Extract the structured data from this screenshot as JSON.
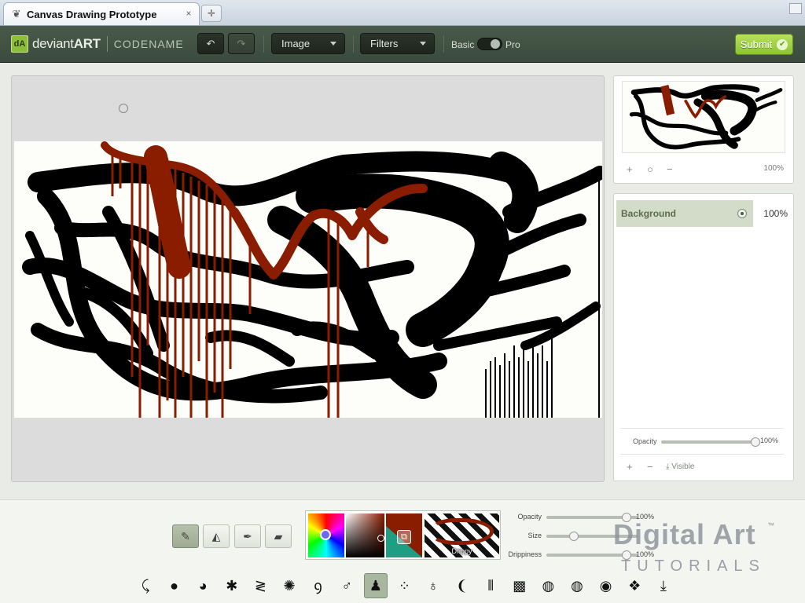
{
  "browser": {
    "tab_title": "Canvas Drawing Prototype",
    "tab_close": "×",
    "new_tab": "✛",
    "favicon": "fox-icon"
  },
  "toolbar": {
    "brand": "deviant",
    "brand_bold": "ART",
    "brand_icon_text": "dA",
    "codename": "CODENAME",
    "undo_icon": "↶",
    "redo_icon": "↷",
    "image_menu": "Image",
    "filters_menu": "Filters",
    "mode_basic": "Basic",
    "mode_pro": "Pro",
    "submit": "Submit",
    "submit_check": "✔"
  },
  "canvas": {
    "accent_red": "#8a1c00",
    "ink": "#000000"
  },
  "navigator": {
    "zoom_in": "+",
    "zoom_reset": "○",
    "zoom_out": "−",
    "zoom_level": "100%"
  },
  "layers": {
    "items": [
      {
        "name": "Background",
        "opacity": "100%"
      }
    ],
    "opacity_label": "Opacity",
    "opacity_value": "100%",
    "opacity_fraction": 1.0,
    "add": "+",
    "remove": "−",
    "visible": "⤓ Visible"
  },
  "tools": [
    {
      "name": "brush-tool",
      "glyph": "✎",
      "active": true
    },
    {
      "name": "fill-tool",
      "glyph": "◭",
      "active": false
    },
    {
      "name": "eyedropper-tool",
      "glyph": "✒",
      "active": false
    },
    {
      "name": "eraser-tool",
      "glyph": "▰",
      "active": false
    }
  ],
  "swatches": {
    "current_color": "#8a1c00",
    "brush_label": "Drippy"
  },
  "brush_params": {
    "opacity_label": "Opacity",
    "opacity_value": "100%",
    "opacity_fraction": 0.88,
    "size_label": "Size",
    "size_value": "",
    "size_fraction": 0.3,
    "drippiness_label": "Drippiness",
    "drippiness_value": "100%",
    "drippiness_fraction": 0.88
  },
  "brushes": [
    {
      "name": "squiggle-brush",
      "glyph": "⤹"
    },
    {
      "name": "round-brush",
      "glyph": "●"
    },
    {
      "name": "split-circle-brush",
      "glyph": "◕"
    },
    {
      "name": "splat-brush",
      "glyph": "✱"
    },
    {
      "name": "spring-brush",
      "glyph": "≷"
    },
    {
      "name": "star-burst-brush",
      "glyph": "✺"
    },
    {
      "name": "curl-brush",
      "glyph": "ꝯ"
    },
    {
      "name": "male-symbol-brush",
      "glyph": "♂"
    },
    {
      "name": "drippy-brush",
      "glyph": "♟",
      "active": true
    },
    {
      "name": "dots-brush",
      "glyph": "⁘"
    },
    {
      "name": "ring-brush",
      "glyph": "♁"
    },
    {
      "name": "feather-brush",
      "glyph": "❨"
    },
    {
      "name": "lines-brush",
      "glyph": "⦀"
    },
    {
      "name": "crosshatch-brush",
      "glyph": "▩"
    },
    {
      "name": "dotted-circle-brush",
      "glyph": "◍"
    },
    {
      "name": "striped-circle-brush",
      "glyph": "◍"
    },
    {
      "name": "mottled-brush",
      "glyph": "◉"
    },
    {
      "name": "cube-brush",
      "glyph": "❖"
    },
    {
      "name": "download-brush",
      "glyph": "⤓"
    }
  ],
  "watermark": {
    "title": "Digital Art",
    "tm": "™",
    "subtitle": "TUTORIALS"
  }
}
